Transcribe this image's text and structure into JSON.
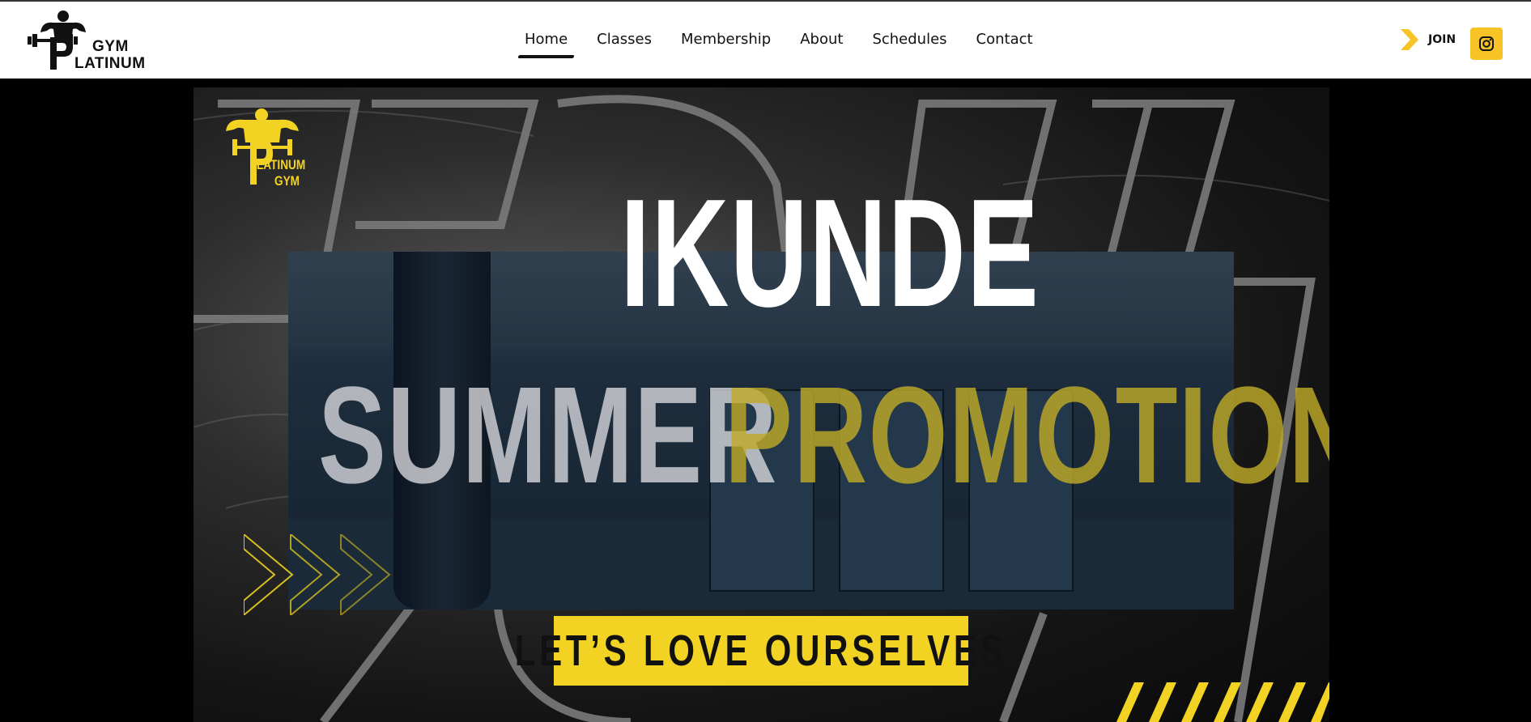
{
  "header": {
    "logo": {
      "line1": "GYM",
      "line2": "LATINUM"
    },
    "nav": [
      "Home",
      "Classes",
      "Membership",
      "About",
      "Schedules",
      "Contact"
    ],
    "active_nav": "Home",
    "join_label": "JOIN",
    "social_icon": "instagram-icon"
  },
  "hero": {
    "logo": {
      "line1": "LATINUM",
      "line2": "GYM"
    },
    "headline": "IKUNDE",
    "subtitle_white": "SUMMER",
    "subtitle_yellow": "PROMOTION",
    "tagline": "LET’S LOVE OURSELVES"
  },
  "colors": {
    "accent_yellow": "#f2d323",
    "join_arrow": "#f7c325",
    "header_bg": "#ffffff",
    "page_bg": "#000000"
  }
}
